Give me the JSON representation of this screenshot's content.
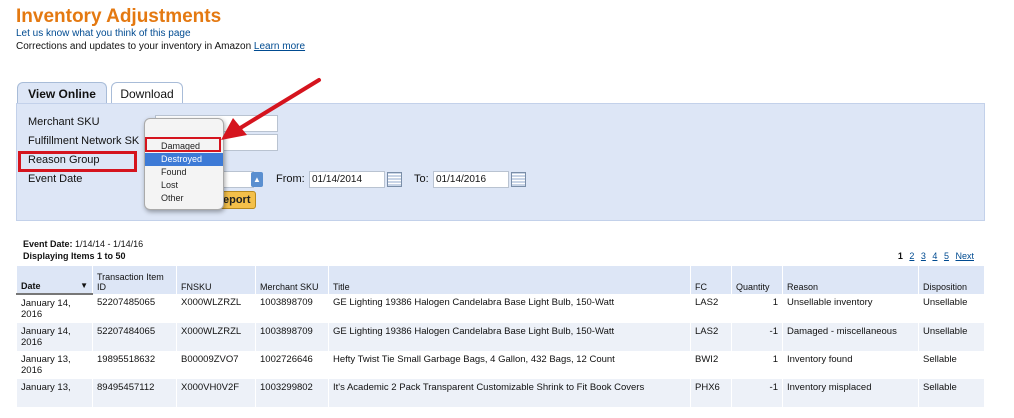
{
  "page": {
    "title": "Inventory Adjustments",
    "feedback_link": "Let us know what you think of this page",
    "description": "Corrections and updates to your inventory in Amazon",
    "learn_more": "Learn more"
  },
  "tabs": [
    {
      "label": "View Online",
      "active": true
    },
    {
      "label": "Download",
      "active": false
    }
  ],
  "filters": {
    "merchant_sku_label": "Merchant SKU",
    "fnsku_label": "Fulfillment Network SK",
    "reason_group_label": "Reason Group",
    "event_date_label": "Event Date",
    "from_label": "From:",
    "from_value": "01/14/2014",
    "to_label": "To:",
    "to_value": "01/14/2016",
    "report_button": "eport"
  },
  "reason_dropdown": {
    "options": [
      "Damaged",
      "Destroyed",
      "Found",
      "Lost",
      "Other"
    ],
    "highlighted": "Destroyed",
    "boxed": "Damaged"
  },
  "results": {
    "event_date_label": "Event Date:",
    "event_date_value": "1/14/14 - 1/14/16",
    "displaying": "Displaying Items 1 to 50",
    "pages": [
      "1",
      "2",
      "3",
      "4",
      "5"
    ],
    "current_page": "1",
    "next": "Next"
  },
  "table": {
    "headers": [
      "Date",
      "Transaction Item ID",
      "FNSKU",
      "Merchant SKU",
      "Title",
      "FC",
      "Quantity",
      "Reason",
      "Disposition"
    ],
    "rows": [
      [
        "January 14, 2016",
        "52207485065",
        "X000WLZRZL",
        "1003898709",
        "GE Lighting 19386 Halogen Candelabra Base Light Bulb, 150-Watt",
        "LAS2",
        "1",
        "Unsellable inventory",
        "Unsellable"
      ],
      [
        "January 14, 2016",
        "52207484065",
        "X000WLZRZL",
        "1003898709",
        "GE Lighting 19386 Halogen Candelabra Base Light Bulb, 150-Watt",
        "LAS2",
        "-1",
        "Damaged - miscellaneous",
        "Unsellable"
      ],
      [
        "January 13, 2016",
        "19895518632",
        "B00009ZVO7",
        "1002726646",
        "Hefty Twist Tie Small Garbage Bags, 4 Gallon, 432 Bags, 12 Count",
        "BWI2",
        "1",
        "Inventory found",
        "Sellable"
      ],
      [
        "January 13,",
        "89495457112",
        "X000VH0V2F",
        "1003299802",
        "It's Academic 2 Pack Transparent Customizable Shrink to Fit Book Covers",
        "PHX6",
        "-1",
        "Inventory misplaced",
        "Sellable"
      ]
    ]
  },
  "colors": {
    "title": "#e47911",
    "panel": "#dde6f6",
    "annotation_red": "#d5141e",
    "dropdown_highlight": "#3d7ad6"
  }
}
